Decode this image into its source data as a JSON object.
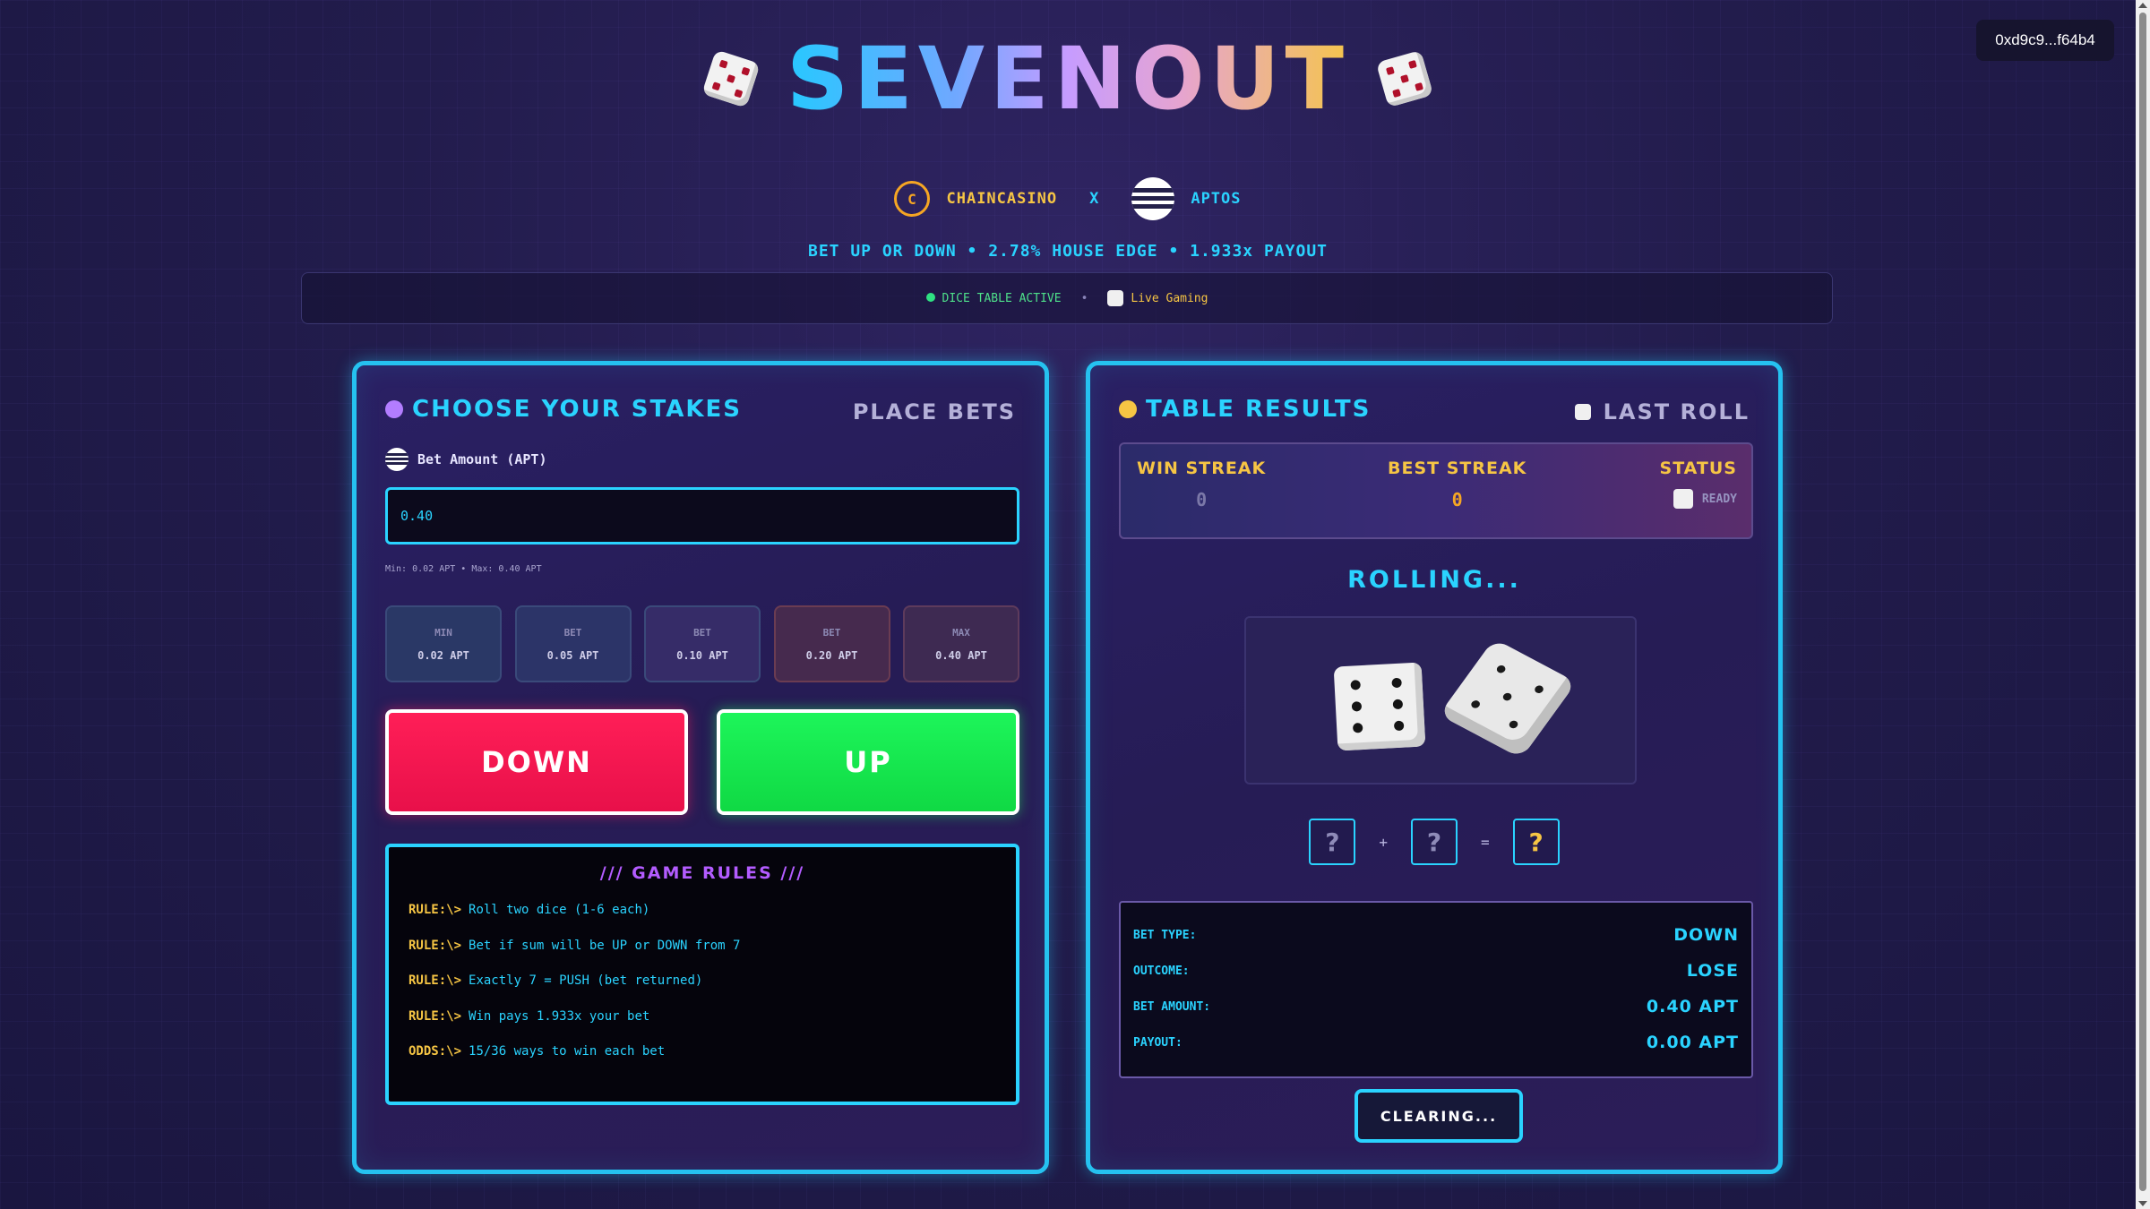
{
  "wallet": {
    "address": "0xd9c9...f64b4"
  },
  "header": {
    "title": "SEVENOUT",
    "brand_casino": "CHAINCASINO",
    "brand_x": "X",
    "brand_aptos": "APTOS",
    "casino_logo_text": "C",
    "tagline": "BET UP OR DOWN • 2.78% HOUSE EDGE • 1.933x PAYOUT"
  },
  "status_bar": {
    "active_text": "DICE TABLE ACTIVE",
    "separator": "•",
    "live_text": "Live Gaming"
  },
  "stakes_panel": {
    "title": "CHOOSE YOUR STAKES",
    "subtitle": "PLACE BETS",
    "bet_label": "Bet Amount (APT)",
    "bet_value": "0.40",
    "bet_range": "Min: 0.02 APT • Max: 0.40 APT",
    "quick_bets": [
      {
        "label": "MIN",
        "value": "0.02 APT"
      },
      {
        "label": "BET",
        "value": "0.05 APT"
      },
      {
        "label": "BET",
        "value": "0.10 APT"
      },
      {
        "label": "BET",
        "value": "0.20 APT"
      },
      {
        "label": "MAX",
        "value": "0.40 APT"
      }
    ],
    "down_label": "DOWN",
    "up_label": "UP",
    "rules_title": "/// GAME RULES ///",
    "rules": [
      {
        "prefix": "RULE:\\>",
        "text": "Roll two dice (1-6 each)"
      },
      {
        "prefix": "RULE:\\>",
        "text": "Bet if sum will be UP or DOWN from 7"
      },
      {
        "prefix": "RULE:\\>",
        "text": "Exactly 7 = PUSH (bet returned)"
      },
      {
        "prefix": "RULE:\\>",
        "text": "Win pays 1.933x your bet"
      },
      {
        "prefix": "ODDS:\\>",
        "text": "15/36 ways to win each bet"
      }
    ]
  },
  "results_panel": {
    "title": "TABLE RESULTS",
    "subtitle": "LAST ROLL",
    "win_streak_label": "WIN STREAK",
    "win_streak_value": "0",
    "best_streak_label": "BEST STREAK",
    "best_streak_value": "0",
    "status_label": "STATUS",
    "status_value": "READY",
    "rolling_text": "ROLLING...",
    "die1": "?",
    "plus": "+",
    "die2": "?",
    "equals": "=",
    "total": "?",
    "bet_type_label": "BET TYPE:",
    "bet_type_value": "DOWN",
    "outcome_label": "OUTCOME:",
    "outcome_value": "LOSE",
    "bet_amount_label": "BET AMOUNT:",
    "bet_amount_value": "0.40 APT",
    "payout_label": "PAYOUT:",
    "payout_value": "0.00 APT",
    "clear_button": "CLEARING..."
  },
  "colors": {
    "accent_cyan": "#2ad3ff",
    "gold": "#f6c544",
    "down_red": "#ff1e57",
    "up_green": "#1df55a",
    "purple_dot": "#b37dff"
  }
}
